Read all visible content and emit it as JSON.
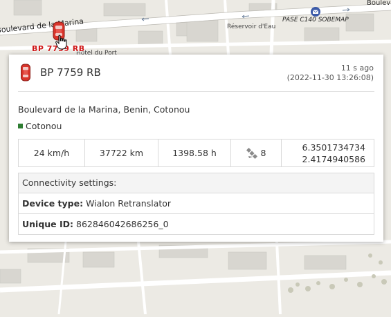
{
  "map": {
    "street_label": "Boulevard de la Marina",
    "reservoir_label": "Réservoir d'Eau",
    "pase_label": "PASE C140 SOBEMAP",
    "boul_label": "Boulevard",
    "hotel_label": "Hôtel du Port",
    "marker_label": "BP 7759 RB",
    "colors": {
      "land": "#eceae4",
      "road": "#ffffff",
      "building": "#d7d5cf",
      "accent": "#d01818"
    }
  },
  "popup": {
    "unit_name": "BP 7759 RB",
    "time_ago": "11 s ago",
    "time_full": "(2022-11-30 13:26:08)",
    "address": "Boulevard de la Marina, Benin, Cotonou",
    "geofence": "Cotonou",
    "geofence_color": "#2e7d32",
    "stats": {
      "speed": "24 km/h",
      "mileage": "37722 km",
      "engine_hours": "1398.58 h",
      "satellites": "8",
      "latitude": "6.3501734734",
      "longitude": "2.4174940586"
    },
    "connectivity": {
      "header": "Connectivity settings:",
      "device_type_label": "Device type:",
      "device_type": "Wialon Retranslator",
      "unique_id_label": "Unique ID:",
      "unique_id": "862846042686256_0"
    }
  }
}
